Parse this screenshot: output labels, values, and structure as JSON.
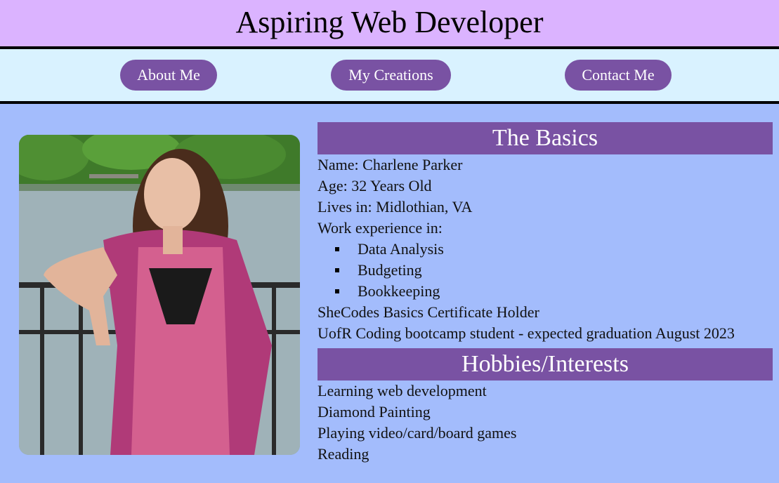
{
  "header": {
    "title": "Aspiring Web Developer"
  },
  "nav": {
    "about": "About Me",
    "creations": "My Creations",
    "contact": "Contact Me"
  },
  "photo": {
    "description": "portrait-photo"
  },
  "basics": {
    "title": "The Basics",
    "name": "Name: Charlene Parker",
    "age": "Age: 32 Years Old",
    "lives": "Lives in: Midlothian, VA",
    "work_heading": "Work experience in:",
    "work_items": [
      "Data Analysis",
      "Budgeting",
      "Bookkeeping"
    ],
    "cert": "SheCodes Basics Certificate Holder",
    "bootcamp": "UofR Coding bootcamp student - expected graduation August 2023"
  },
  "hobbies": {
    "title": "Hobbies/Interests",
    "items": [
      "Learning web development",
      "Diamond Painting",
      "Playing video/card/board games",
      "Reading"
    ]
  },
  "colors": {
    "header_bg": "#dbb3ff",
    "nav_bg": "#d9f2ff",
    "page_bg": "#a3bcfc",
    "accent": "#7952a3"
  }
}
